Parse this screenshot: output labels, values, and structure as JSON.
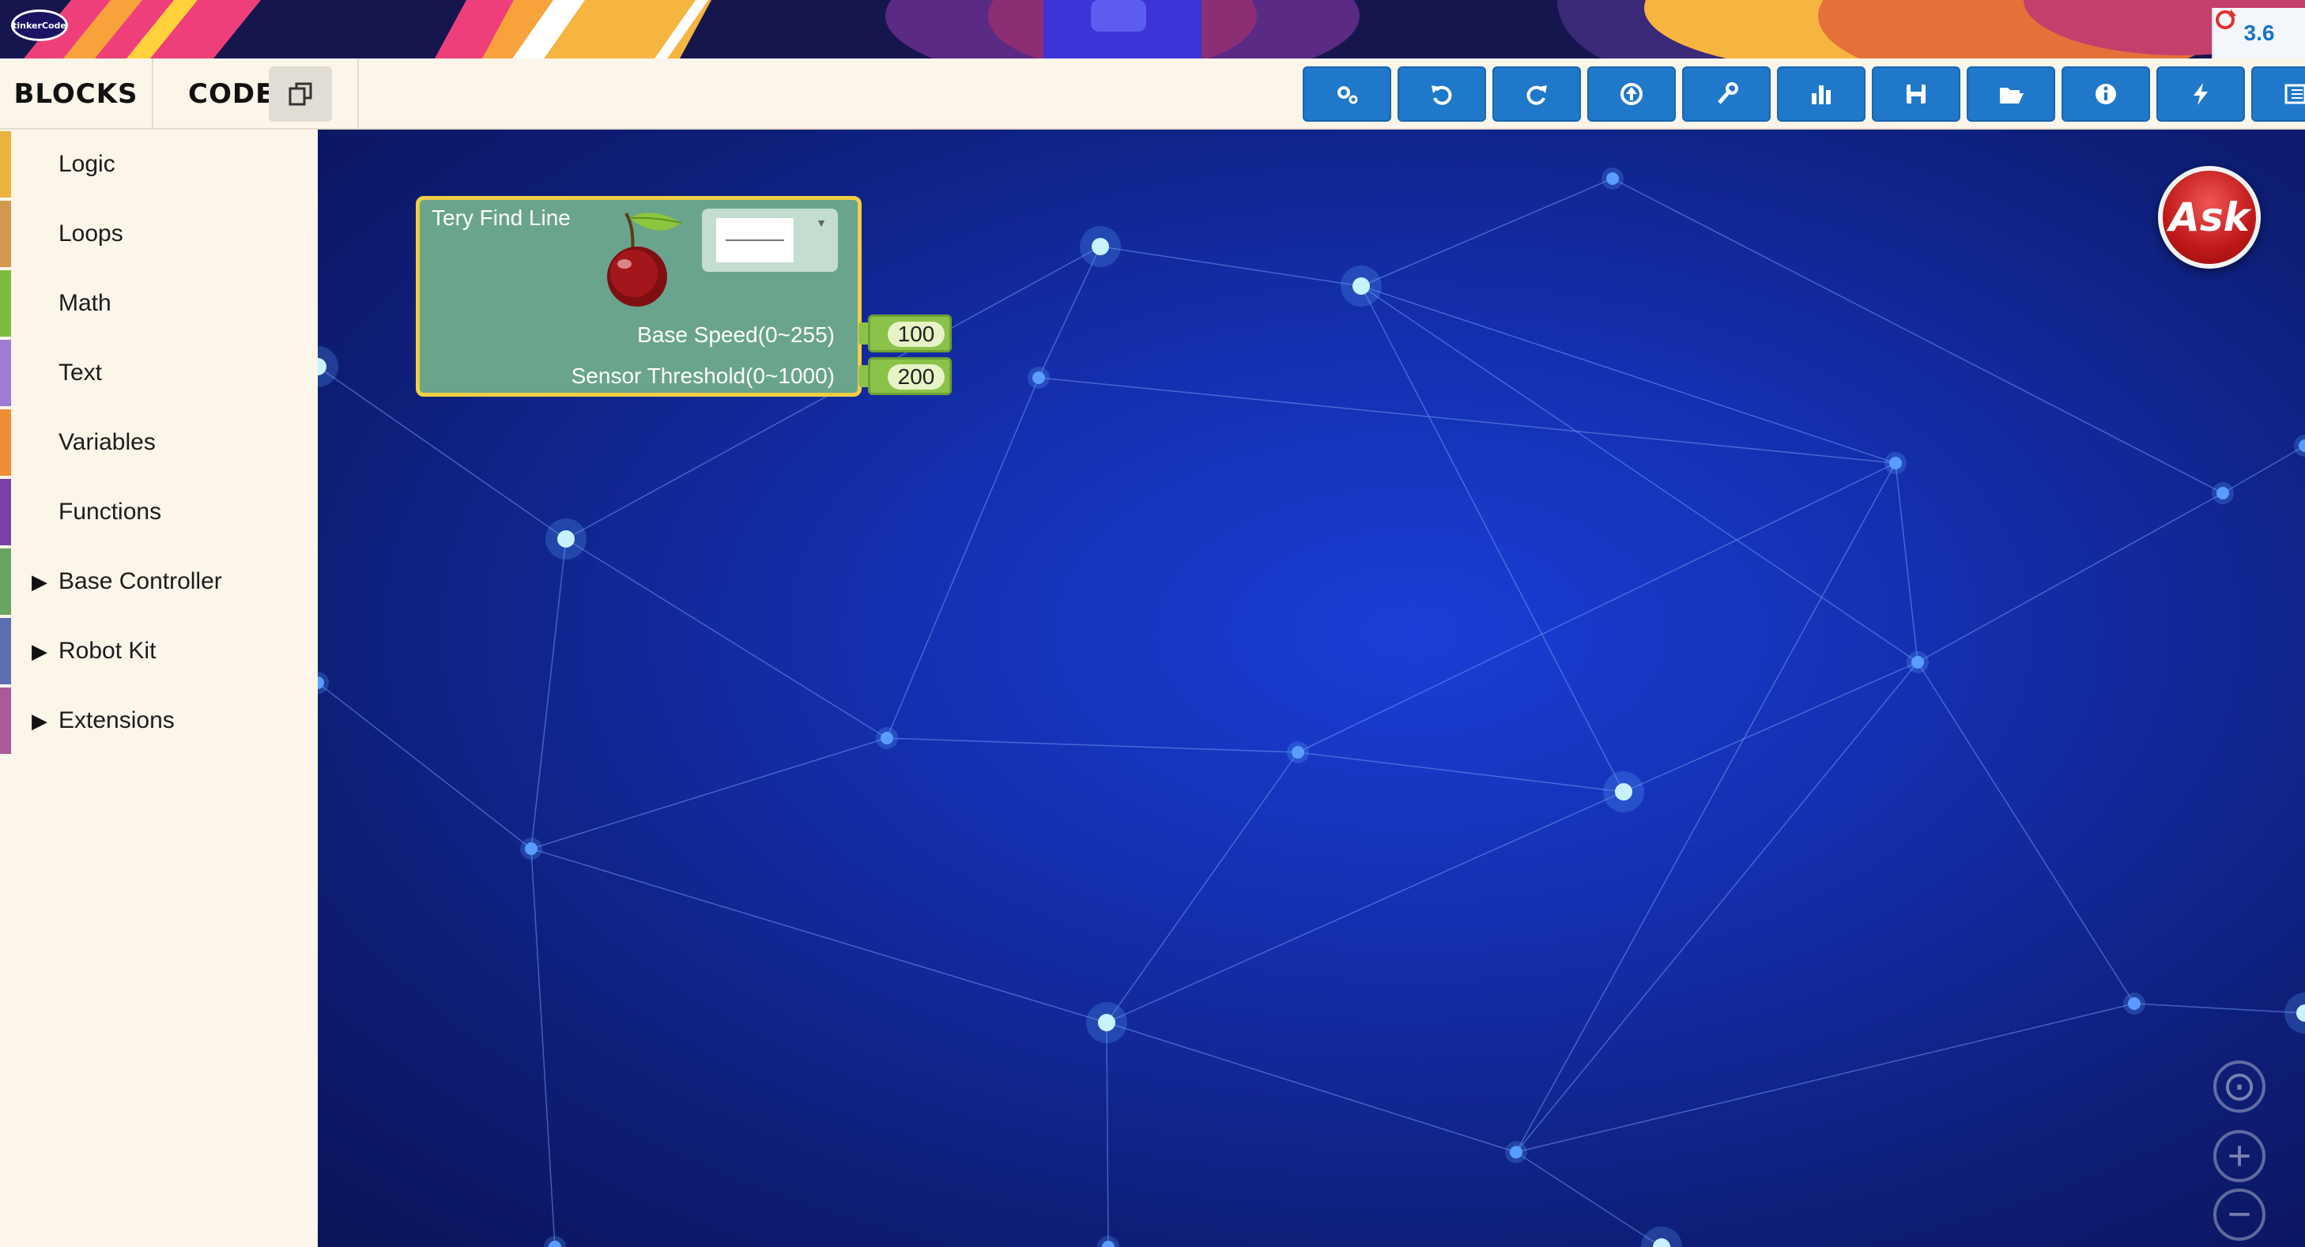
{
  "banner": {
    "logo_text": "tinkerCode",
    "version": "3.6"
  },
  "tabs": {
    "blocks": "BLOCKS",
    "code": "CODE"
  },
  "toolbar": {
    "buttons": [
      {
        "icon": "gears-icon"
      },
      {
        "icon": "undo-icon"
      },
      {
        "icon": "redo-icon"
      },
      {
        "icon": "upload-icon"
      },
      {
        "icon": "wrench-icon"
      },
      {
        "icon": "chart-icon"
      },
      {
        "icon": "save-icon"
      },
      {
        "icon": "folder-open-icon"
      },
      {
        "icon": "info-icon"
      },
      {
        "icon": "flash-icon"
      },
      {
        "icon": "list-icon"
      }
    ]
  },
  "palette": {
    "categories": [
      {
        "label": "Logic",
        "color": "#e9b43f",
        "expandable": false
      },
      {
        "label": "Loops",
        "color": "#d39a4f",
        "expandable": false
      },
      {
        "label": "Math",
        "color": "#7cbc3d",
        "expandable": false
      },
      {
        "label": "Text",
        "color": "#9e7cd6",
        "expandable": false
      },
      {
        "label": "Variables",
        "color": "#ef8d36",
        "expandable": false
      },
      {
        "label": "Functions",
        "color": "#7840a8",
        "expandable": false
      },
      {
        "label": "Base Controller",
        "color": "#6aa460",
        "expandable": true
      },
      {
        "label": "Robot Kit",
        "color": "#5b70b3",
        "expandable": true
      },
      {
        "label": "Extensions",
        "color": "#a85a9c",
        "expandable": true
      }
    ]
  },
  "block": {
    "title": "Tery Find Line",
    "params": [
      {
        "label": "Base Speed(0~255)",
        "value": "100"
      },
      {
        "label": "Sensor Threshold(0~1000)",
        "value": "200"
      }
    ],
    "colors": {
      "body": "#6aa48c",
      "border": "#f0cf45",
      "number": "#8bc34a"
    }
  },
  "ask_button": {
    "label": "Ask"
  },
  "zoom": {
    "center": "⊙",
    "in": "+",
    "out": "−"
  },
  "colors": {
    "toolbar": "#1f78c9",
    "workspace": "#142fae"
  }
}
